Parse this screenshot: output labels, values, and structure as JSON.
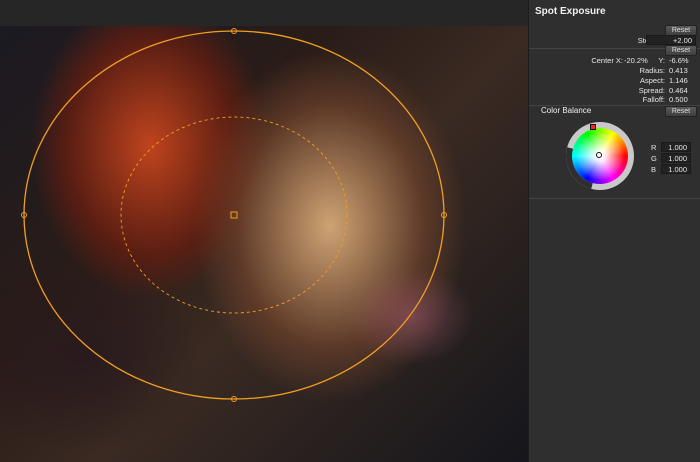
{
  "panel": {
    "title": "Spot Exposure",
    "reset_label": "Reset",
    "stops": {
      "label": "Stops:",
      "value": "+2.00"
    },
    "center": {
      "x_label": "Center X:",
      "x_value": "-20.2%",
      "y_label": "Y:",
      "y_value": "-6.6%"
    },
    "params": [
      {
        "label": "Radius:",
        "value": "0.413"
      },
      {
        "label": "Aspect:",
        "value": "1.146"
      },
      {
        "label": "Spread:",
        "value": "0.464"
      },
      {
        "label": "Falloff:",
        "value": "0.500"
      }
    ],
    "color_balance": {
      "title": "Color Balance",
      "r": {
        "label": "R",
        "value": "1.000"
      },
      "g": {
        "label": "G",
        "value": "1.000"
      },
      "b": {
        "label": "B",
        "value": "1.000"
      }
    }
  },
  "overlay": {
    "ellipse_color": "#f0a020"
  },
  "icons": [
    "color-wheel-icon"
  ]
}
